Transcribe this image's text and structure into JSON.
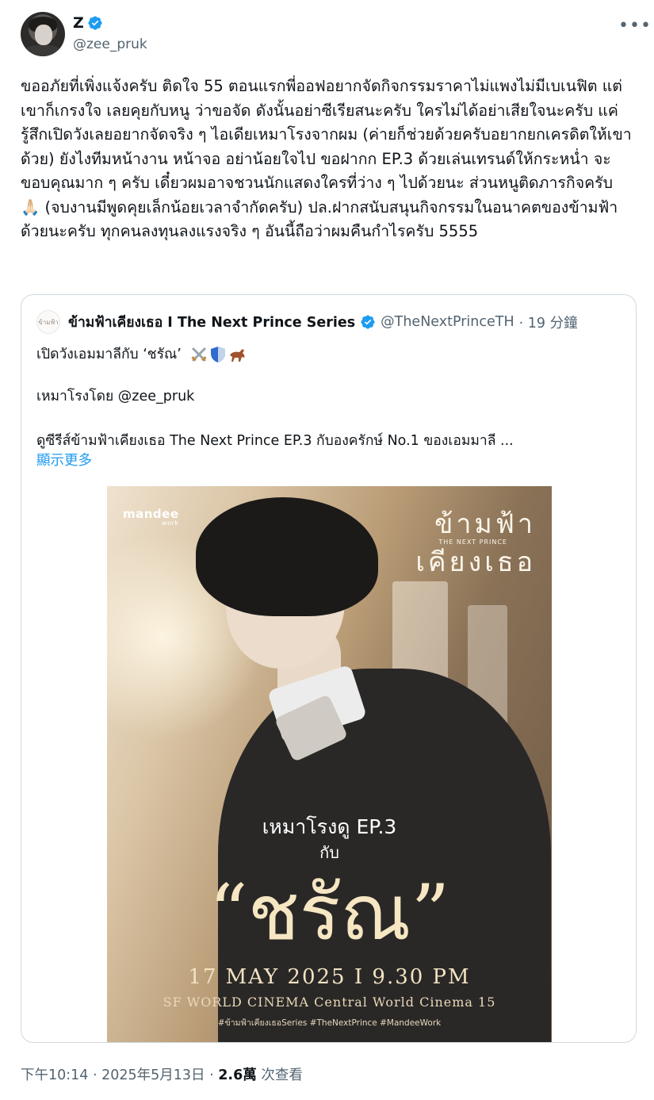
{
  "author": {
    "name": "Z",
    "handle": "@zee_pruk"
  },
  "post": {
    "text": "ขออภัยที่เพิ่งแจ้งครับ ติดใจ 55 ตอนแรกพี่ออฟอยากจัดกิจกรรมราคาไม่แพงไม่มีเบเนฟิต แต่เขาก็เกรงใจ เลยคุยกับหนู ว่าขอจัด ดังนั้นอย่าซีเรียสนะครับ ใครไม่ได้อย่าเสียใจนะครับ แค่รู้สึกเปิดวังเลยอยากจัดจริง ๆ ไอเดียเหมาโรงจากผม (ค่ายก็ช่วยด้วยครับอยากยกเครดิตให้เขาด้วย) ยังไงทีมหน้างาน หน้าจอ อย่าน้อยใจไป ขอฝากก EP.3 ด้วยเล่นเทรนด์ให้กระหน่ำ จะขอบคุณมาก ๆ ครับ เดี๋ยวผมอาจชวนนักแสดงใครที่ว่าง ๆ ไปด้วยนะ ส่วนหนูติดภารกิจครับ 🙏🏻 (จบงานมีพูดคุยเล็กน้อยเวลาจำกัดครับ) ปล.ฝากสนับสนุนกิจกรรมในอนาคตของข้ามฟ้าด้วยนะครับ ทุกคนลงทุนลงแรงจริง ๆ อันนี้ถือว่าผมคืนกำไรครับ 5555"
  },
  "quote": {
    "name": "ข้ามฟ้าเคียงเธอ I The Next Prince Series",
    "handle": "@TheNextPrinceTH",
    "time": "· 19 分鐘",
    "line1": "เปิดวังเอมมาลีกับ ‘ชรัณ’",
    "line2": "เหมาโรงโดย @zee_pruk",
    "line3": "ดูซีรีส์ข้ามฟ้าเคียงเธอ The Next Prince EP.3 กับองครักษ์ No.1 ของเอมมาลี ...",
    "show_more": "顯示更多",
    "avatar_text": "ข้ามฟ้า"
  },
  "poster": {
    "logo": "mandee",
    "logo_sub": "work",
    "title_line1": "ข้ามฟ้า",
    "title_line2": "เคียงเธอ",
    "title_tag": "THE NEXT PRINCE",
    "headline": "เหมาโรงดู EP.3",
    "with": "กับ",
    "character": "“ชรัณ”",
    "date": "17 MAY 2025 I 9.30 PM",
    "venue": "SF WORLD CINEMA Central World Cinema 15",
    "hashtags": "#ข้ามฟ้าเคียงเธอSeries   #TheNextPrince   #MandeeWork"
  },
  "footer": {
    "time": "下午10:14 · 2025年5月13日 · ",
    "views": "2.6萬",
    "views_label": " 次查看"
  },
  "colors": {
    "verified": "#1d9bf0",
    "link": "#1d9bf0",
    "muted": "#536471"
  },
  "icons": [
    "verified-badge-icon",
    "more-dots-icon",
    "swords-emoji-icon",
    "shield-emoji-icon",
    "horse-emoji-icon"
  ]
}
